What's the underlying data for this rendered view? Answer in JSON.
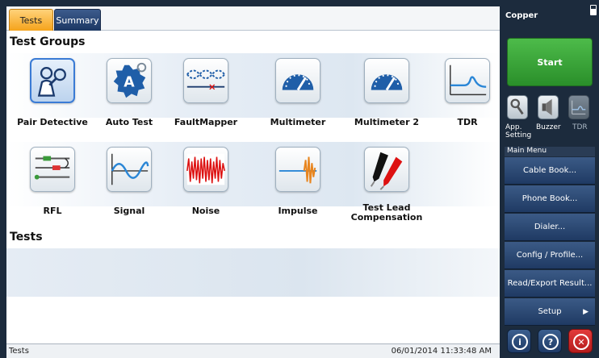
{
  "tabs": [
    {
      "label": "Tests"
    },
    {
      "label": "Summary"
    }
  ],
  "sections": {
    "test_groups_title": "Test Groups",
    "tests_title": "Tests"
  },
  "test_groups": [
    {
      "label": "Pair Detective",
      "icon": "detective-icon",
      "selected": true
    },
    {
      "label": "Auto Test",
      "icon": "auto-test-icon"
    },
    {
      "label": "FaultMapper",
      "icon": "fault-mapper-icon"
    },
    {
      "label": "Multimeter",
      "icon": "gauge-icon"
    },
    {
      "label": "Multimeter 2",
      "icon": "gauge-icon"
    },
    {
      "label": "TDR",
      "icon": "tdr-trace-icon"
    },
    {
      "label": "RFL",
      "icon": "rfl-icon"
    },
    {
      "label": "Signal",
      "icon": "sine-wave-icon"
    },
    {
      "label": "Noise",
      "icon": "noise-icon"
    },
    {
      "label": "Impulse",
      "icon": "impulse-icon"
    },
    {
      "label": "Test Lead Compensation",
      "icon": "test-leads-icon"
    }
  ],
  "auto_test_glyph": "A",
  "status": {
    "left": "Tests",
    "datetime": "06/01/2014 11:33:48 AM"
  },
  "right_panel": {
    "title": "Copper",
    "start_label": "Start",
    "quick_icons": [
      {
        "label": "App. Setting",
        "icon": "wrench-icon"
      },
      {
        "label": "Buzzer",
        "icon": "speaker-icon"
      },
      {
        "label": "TDR",
        "icon": "tdr-icon"
      }
    ],
    "menu_header": "Main Menu",
    "menu_items": [
      {
        "label": "Cable Book..."
      },
      {
        "label": "Phone Book..."
      },
      {
        "label": "Dialer..."
      },
      {
        "label": "Config / Profile..."
      },
      {
        "label": "Read/Export Result..."
      },
      {
        "label": "Setup",
        "arrow": "▶"
      }
    ],
    "bottom_buttons": [
      {
        "glyph": "i",
        "icon": "info-icon"
      },
      {
        "glyph": "?",
        "icon": "help-icon"
      },
      {
        "glyph": "✕",
        "icon": "close-icon"
      }
    ]
  },
  "colors": {
    "accent_tab": "#f5a31b",
    "panel_bg": "#1c2b3d",
    "start_green": "#2a8f2a",
    "close_red": "#c42121"
  }
}
